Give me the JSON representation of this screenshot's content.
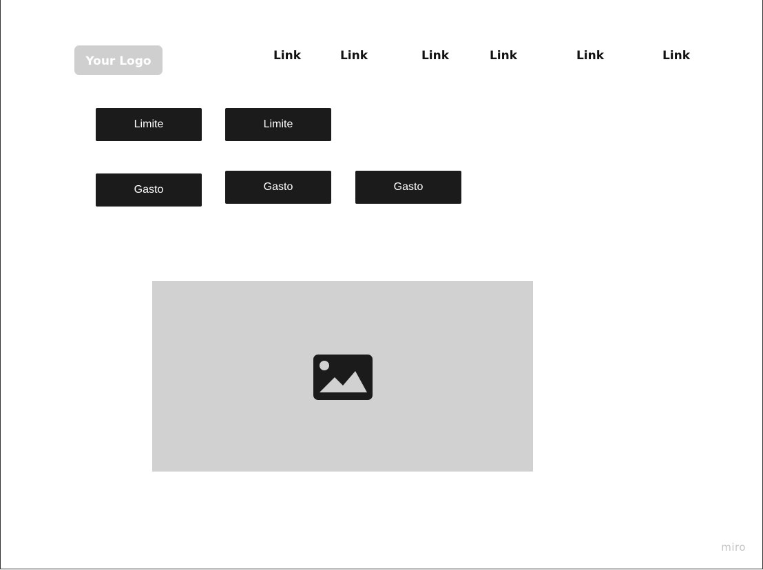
{
  "header": {
    "logo_text": "Your Logo",
    "nav_links": [
      "Link",
      "Link",
      "Link",
      "Link",
      "Link",
      "Link"
    ]
  },
  "buttons": {
    "limite": [
      "Limite",
      "Limite"
    ],
    "gasto": [
      "Gasto",
      "Gasto",
      "Gasto"
    ]
  },
  "main": {
    "image_placeholder_icon": "image-icon"
  },
  "footer": {
    "watermark": "miro"
  },
  "colors": {
    "button_background": "#1b1b1b",
    "button_text": "#ffffff",
    "logo_background": "#cfcfcf",
    "placeholder_background": "#d1d1d1",
    "watermark_text": "#c4c4c4"
  }
}
